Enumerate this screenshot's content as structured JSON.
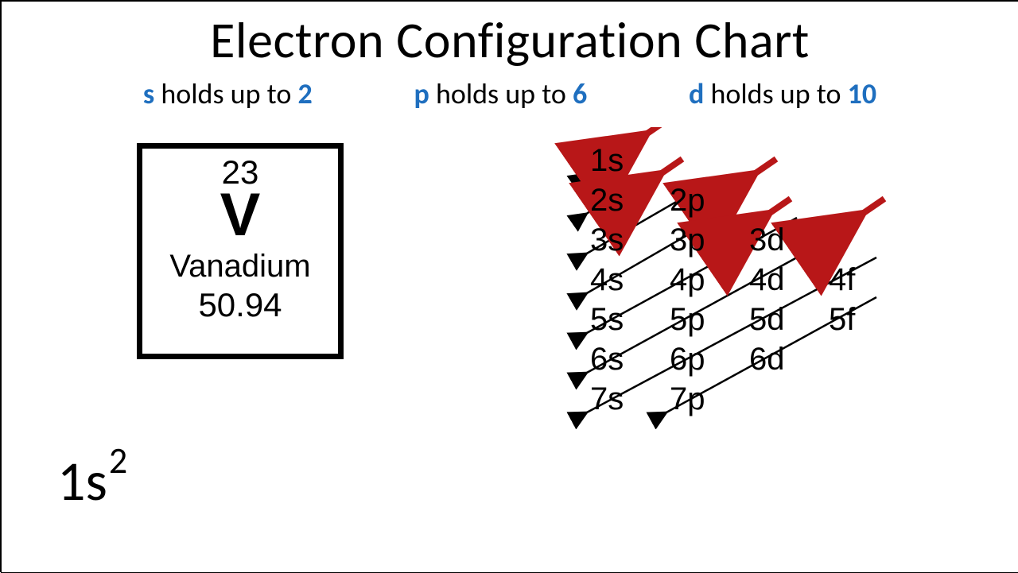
{
  "title": "Electron Configuration Chart",
  "rules": [
    {
      "sub": "s",
      "text": "holds up to",
      "max": "2"
    },
    {
      "sub": "p",
      "text": "holds up to",
      "max": "6"
    },
    {
      "sub": "d",
      "text": "holds up to",
      "max": "10"
    }
  ],
  "element": {
    "atomic_number": "23",
    "symbol": "V",
    "name": "Vanadium",
    "mass": "50.94"
  },
  "aufbau": {
    "rows": [
      [
        "1s"
      ],
      [
        "2s",
        "2p"
      ],
      [
        "3s",
        "3p",
        "3d"
      ],
      [
        "4s",
        "4p",
        "4d",
        "4f"
      ],
      [
        "5s",
        "5p",
        "5d",
        "5f"
      ],
      [
        "6s",
        "6p",
        "6d"
      ],
      [
        "7s",
        "7p"
      ]
    ]
  },
  "config_display": {
    "base": "1s",
    "exp": "2"
  }
}
